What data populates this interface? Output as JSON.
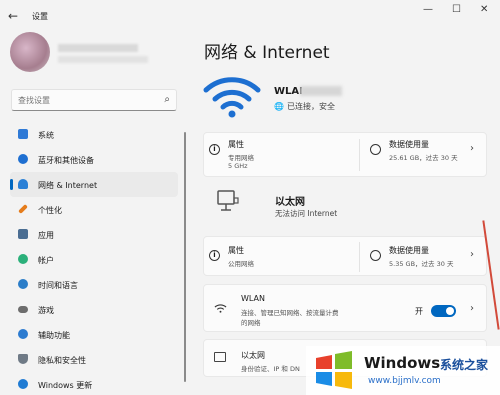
{
  "window": {
    "title": "设置",
    "back": "←",
    "minimize": "—",
    "maximize": "☐",
    "close": "✕"
  },
  "search": {
    "placeholder": "查找设置"
  },
  "sidebar": {
    "items": [
      {
        "label": "系统",
        "icon": "monitor-icon",
        "color": "#2f7ad6"
      },
      {
        "label": "蓝牙和其他设备",
        "icon": "bluetooth-icon",
        "color": "#1e6fd1"
      },
      {
        "label": "网络 & Internet",
        "icon": "wifi-icon",
        "color": "#2a80d6"
      },
      {
        "label": "个性化",
        "icon": "brush-icon",
        "color": "#e57c1b"
      },
      {
        "label": "应用",
        "icon": "apps-icon",
        "color": "#4a6d92"
      },
      {
        "label": "帐户",
        "icon": "person-icon",
        "color": "#2bb07a"
      },
      {
        "label": "时间和语言",
        "icon": "clock-icon",
        "color": "#2b7dc8"
      },
      {
        "label": "游戏",
        "icon": "gamepad-icon",
        "color": "#6d6d6d"
      },
      {
        "label": "辅助功能",
        "icon": "accessibility-icon",
        "color": "#2c7bd0"
      },
      {
        "label": "隐私和安全性",
        "icon": "shield-icon",
        "color": "#6f7a86"
      },
      {
        "label": "Windows 更新",
        "icon": "update-icon",
        "color": "#1f7bd3"
      }
    ],
    "active_index": 2
  },
  "main": {
    "title": "网络 & Internet",
    "wifi": {
      "name": "WLAI",
      "status": "已连接，安全",
      "status_icon": "🌐"
    },
    "wifi_props": {
      "title": "属性",
      "sub1": "专用网络",
      "sub2": "5 GHz"
    },
    "wifi_usage": {
      "title": "数据使用量",
      "detail": "25.61 GB，过去 30 天"
    },
    "ethernet": {
      "title": "以太网",
      "status": "无法访问 Internet"
    },
    "eth_props": {
      "title": "属性",
      "sub1": "公用网络"
    },
    "eth_usage": {
      "title": "数据使用量",
      "detail": "5.35 GB，过去 30 天"
    },
    "wlan_row": {
      "title": "WLAN",
      "desc1": "连接、管理已知网络、按流量计费",
      "desc2": "的网络",
      "toggle_label": "开",
      "toggle_on": true
    },
    "ethernet_row": {
      "title": "以太网",
      "desc": "身份验证、IP 和 DN"
    }
  },
  "watermark": {
    "brand": "Windows",
    "cn": "系统之家",
    "url": "www.bjjmlv.com"
  }
}
